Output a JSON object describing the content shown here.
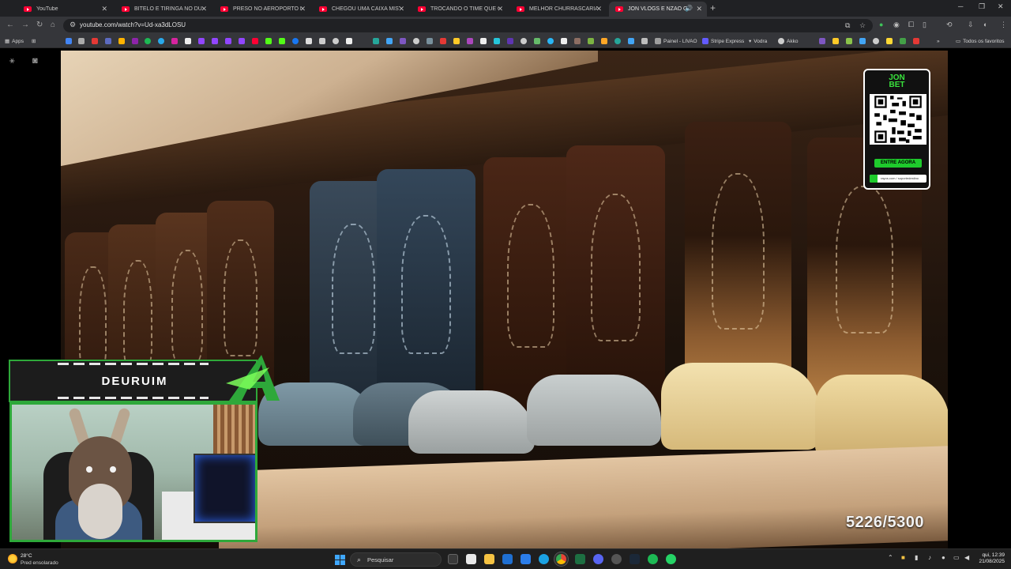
{
  "browser": {
    "tabs": [
      {
        "title": "YouTube",
        "active": false
      },
      {
        "title": "BITELO E TIRINGA NO DUELO I",
        "active": false
      },
      {
        "title": "PRESO NO AEROPORTO POR C",
        "active": false
      },
      {
        "title": "CHEGOU UMA CAIXA MISTERI",
        "active": false
      },
      {
        "title": "TROCANDO O TIME QUE O EN",
        "active": false
      },
      {
        "title": "MELHOR CHURRASCARIA RO",
        "active": false
      },
      {
        "title": "JON VLOGS E NZAO GASTA",
        "active": true
      }
    ],
    "url": "youtube.com/watch?v=Ud-xa3dLOSU",
    "bookmarks": {
      "apps_label": "Apps",
      "painel_label": "Painel - LIVAO",
      "stripe_label": "Stripe Express",
      "vodra_label": "Vodra",
      "akko_label": "Akko",
      "all_favorites_label": "Todos os favoritos"
    }
  },
  "video": {
    "counter": "5226/5300",
    "qr_ad": {
      "brand_line1": "JON",
      "brand_line2": "BET",
      "cta": "ENTRE AGORA",
      "link": "rayos.com / suportedestino"
    },
    "streamer": {
      "name": "DEURUIM"
    }
  },
  "taskbar": {
    "temperature": "28°C",
    "weather": "Pred ensolarado",
    "search_placeholder": "Pesquisar",
    "clock_time": "qui, 12:39",
    "clock_date": "21/08/2025"
  },
  "colors": {
    "accent_green": "#2ea83a",
    "youtube_red": "#ff0033",
    "chrome_dark": "#202124",
    "chrome_bar": "#35363a"
  }
}
